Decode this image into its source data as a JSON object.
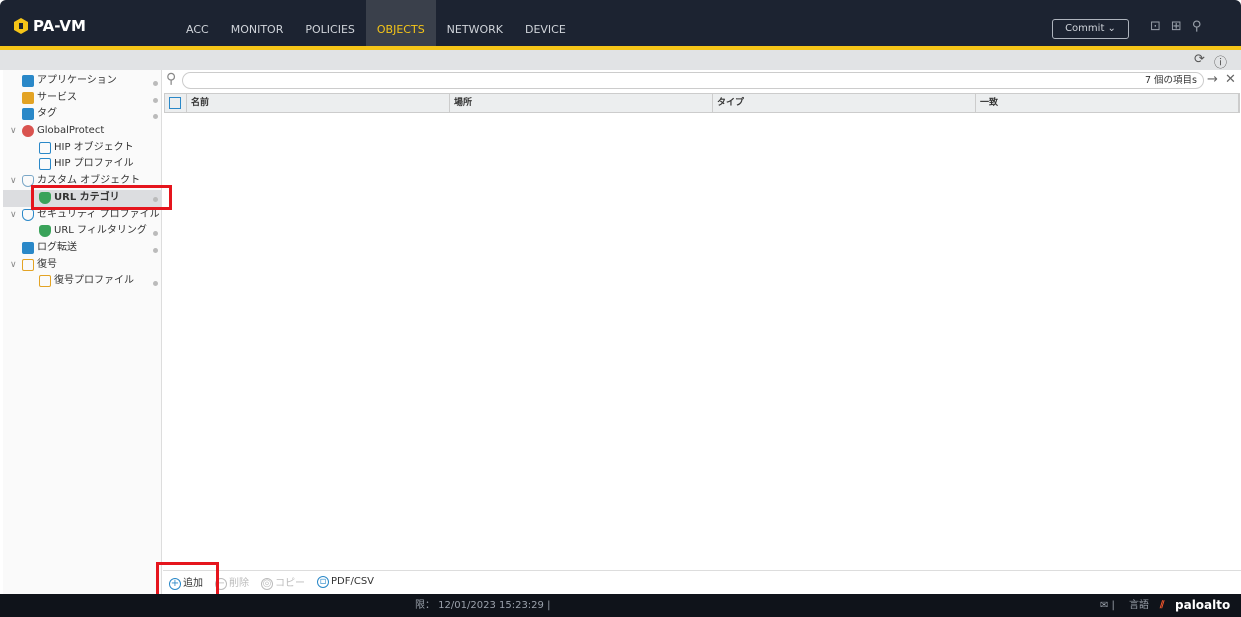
{
  "app": {
    "title": "PA-VM"
  },
  "nav": [
    "ACC",
    "MONITOR",
    "POLICIES",
    "OBJECTS",
    "NETWORK",
    "DEVICE"
  ],
  "header": {
    "commit": "Commit ⌄"
  },
  "sidebar": [
    {
      "label": "アプリケーション",
      "color": "#2a88c8"
    },
    {
      "label": "サービス",
      "color": "#2a88c8"
    },
    {
      "label": "タグ",
      "color": "#e3a324"
    },
    {
      "label": "GlobalProtect",
      "color": "#d9534f"
    },
    {
      "label": "HIP オブジェクト",
      "color": "#2a88c8"
    },
    {
      "label": "HIP プロファイル",
      "color": "#2a88c8"
    },
    {
      "label": "カスタム オブジェクト",
      "color": "#7aa7c7"
    },
    {
      "label": "URL カテゴリ",
      "color": "#3aa35a"
    },
    {
      "label": "セキュリティ プロファイル",
      "color": "#2a88c8"
    },
    {
      "label": "URL フィルタリング",
      "color": "#3aa35a"
    },
    {
      "label": "ログ転送",
      "color": "#2a88c8"
    },
    {
      "label": "復号",
      "color": "#e3a324"
    },
    {
      "label": "復号プロファイル",
      "color": "#e3a324"
    }
  ],
  "search": {
    "count": "7 個の項目s"
  },
  "table": {
    "columns": [
      "名前",
      "場所",
      "タイプ",
      "一致"
    ]
  },
  "actions": {
    "add": "追加",
    "delete": "削除",
    "copy": "コピー",
    "pdf": "PDF/CSV"
  },
  "footer": {
    "time": "限： 12/01/2023 15:23:29 |",
    "lang": "言語",
    "brand": "paloalto"
  }
}
